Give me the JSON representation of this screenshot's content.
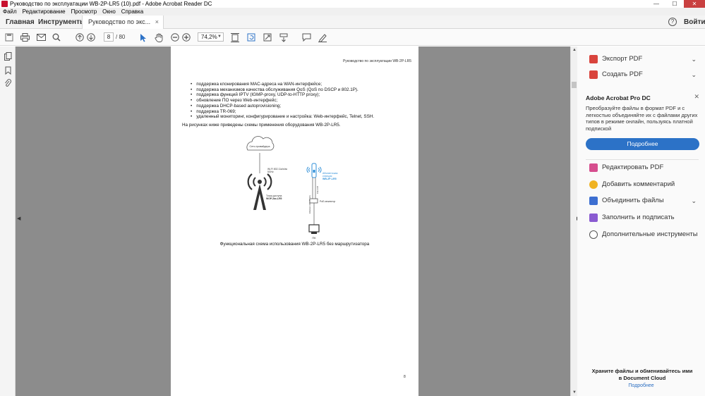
{
  "window": {
    "title": "Руководство по эксплуатации WB-2P-LR5 (10).pdf - Adobe Acrobat Reader DC",
    "minimize": "—",
    "maximize": "☐",
    "close": "✕"
  },
  "menu": [
    "Файл",
    "Редактирование",
    "Просмотр",
    "Окно",
    "Справка"
  ],
  "tabs": {
    "home": "Главная",
    "tools": "Инструменты",
    "document": "Руководство по экс...",
    "document_close": "×",
    "help": "?",
    "signin": "Войти"
  },
  "toolbar": {
    "page_current": "8",
    "page_total": "/ 80",
    "zoom": "74,2%"
  },
  "document": {
    "header": "Руководство по эксплуатации WB-2P-LR5",
    "bullets": [
      "поддержка клонирования MAC-адреса на WAN-интерфейсе;",
      "поддержка механизмов качества обслуживания QoS (QoS по DSCP и 802.1P).",
      "поддержка функций IPTV (IGMP-proxy, UDP-to-HTTP proxy);",
      "обновление ПО через Web-интерфейс;",
      "поддержка DHCP-based autoprovisioning;",
      "поддержка TR-069;",
      "удаленный мониторинг, конфигурирование и настройка: Web-интерфейс, Telnet, SSH."
    ],
    "paragraph": "На рисунках ниже приведены схемы применения оборудования WB-2P-LR5.",
    "diagram": {
      "cloud": "Сеть провайдера",
      "wifi_label_1": "Wi-Fi 802.11a/n/ac",
      "wifi_label_2": "5GHz",
      "access_point_1": "Точка доступа",
      "access_point_2": "WOP-2ac-LR5",
      "station_1": "Абонентская",
      "station_2": "станция",
      "station_3": "WB-2P-LR5",
      "cable_1": "PoE 24 В",
      "cable_2": "Ethernet (100 Мбит/с)",
      "poe": "PoE-инжектор",
      "pc": "ПК"
    },
    "caption": "Функциональная схема использования WB-2P-LR5 без маршрутизатора",
    "page_number": "8"
  },
  "right_panel": {
    "export_pdf": "Экспорт PDF",
    "create_pdf": "Создать PDF",
    "promo_title": "Adobe Acrobat Pro DC",
    "promo_text": "Преобразуйте файлы в формат PDF и с легкостью объединяйте их с файлами других типов в режиме онлайн, пользуясь платной подпиской",
    "promo_button": "Подробнее",
    "promo_close": "✕",
    "edit_pdf": "Редактировать PDF",
    "add_comment": "Добавить комментарий",
    "combine_files": "Объединить файлы",
    "fill_sign": "Заполнить и подписать",
    "more_tools": "Дополнительные инструменты",
    "cloud_title": "Храните файлы и обменивайтесь ими в Document Cloud",
    "cloud_link": "Подробнее"
  },
  "colors": {
    "accent": "#2c72c7",
    "export_icon": "#d9443d",
    "create_icon": "#d9443d",
    "edit_icon": "#d64e8e",
    "comment_icon": "#f0b323",
    "combine_icon": "#3d6fd1",
    "fill_icon": "#8a5bd1",
    "station_blue": "#2f8fd8"
  }
}
